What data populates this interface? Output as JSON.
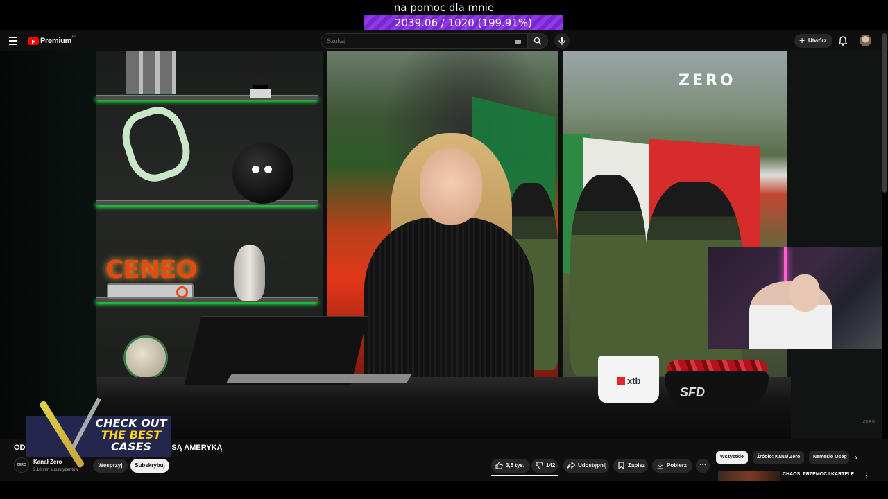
{
  "overlay": {
    "title": "na pomoc dla mnie",
    "progress_text": "2039.06 / 1020 (199.91%)",
    "progress_fraction": 1.9991
  },
  "topbar": {
    "logo_text": "Premium",
    "logo_region": "PL",
    "search_placeholder": "Szukaj",
    "create_label": "Utwórz"
  },
  "video": {
    "sign_text": "CENEO",
    "brand_watermark": "ZERO",
    "mug_text": "xtb",
    "bowl_text": "SFD",
    "corner_watermark": "ZERO"
  },
  "promo": {
    "line1": "CHECK OUT",
    "line2": "THE BEST",
    "line3": "CASES"
  },
  "details": {
    "title_start": "OD",
    "title_end": "ĘSĄ AMERYKĄ",
    "channel_avatar_text": "ZERO",
    "channel_name": "Kanał Zero",
    "subscribers": "2,18 mln subskrybentów",
    "support_label": "Wesprzyj",
    "subscribe_label": "Subskrybuj",
    "likes": "3,5 tys.",
    "dislikes": "142",
    "share_label": "Udostępnij",
    "save_label": "Zapisz",
    "download_label": "Pobierz",
    "more_label": "⋯"
  },
  "chips": {
    "all": "Wszystkie",
    "source": "Źródło: Kanał Zero",
    "third": "Nemesio Oseg"
  },
  "recommendation": {
    "title": "CHAOS, PRZEMOC I KARTELE",
    "title2": "",
    "more": "⋮"
  },
  "colors": {
    "accent_red": "#ff0000",
    "overlay_purple": "#7a25d0",
    "dark_bg": "#0f0f0f"
  }
}
